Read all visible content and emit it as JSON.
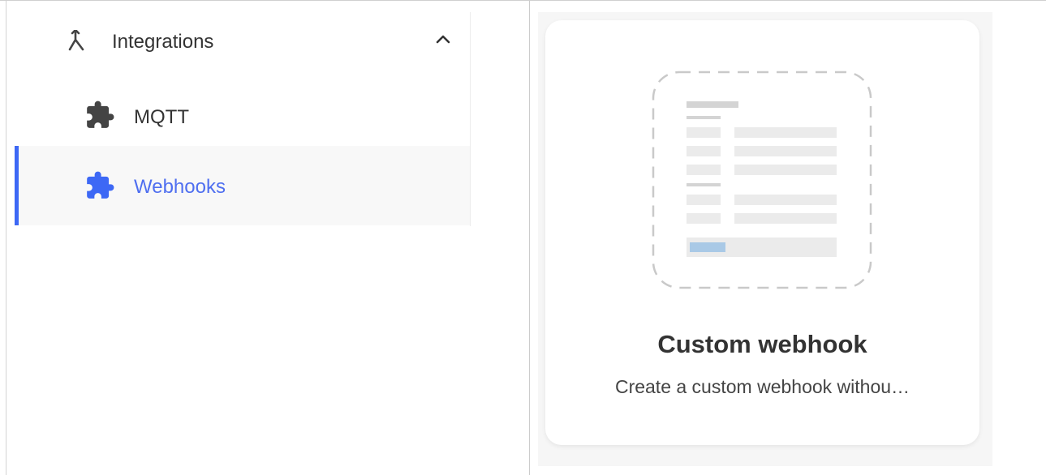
{
  "sidebar": {
    "group": {
      "label": "Integrations",
      "icon": "merge-arrow-icon",
      "expanded": true
    },
    "items": [
      {
        "label": "MQTT",
        "icon": "puzzle-piece-icon",
        "active": false
      },
      {
        "label": "Webhooks",
        "icon": "puzzle-piece-icon",
        "active": true
      }
    ]
  },
  "card": {
    "title": "Custom webhook",
    "description": "Create a custom webhook withou…",
    "illustration": "form-placeholder-illustration"
  },
  "colors": {
    "accent": "#3d68f5",
    "active_text": "#4f6ff0",
    "text": "#333333",
    "icon": "#444444"
  }
}
